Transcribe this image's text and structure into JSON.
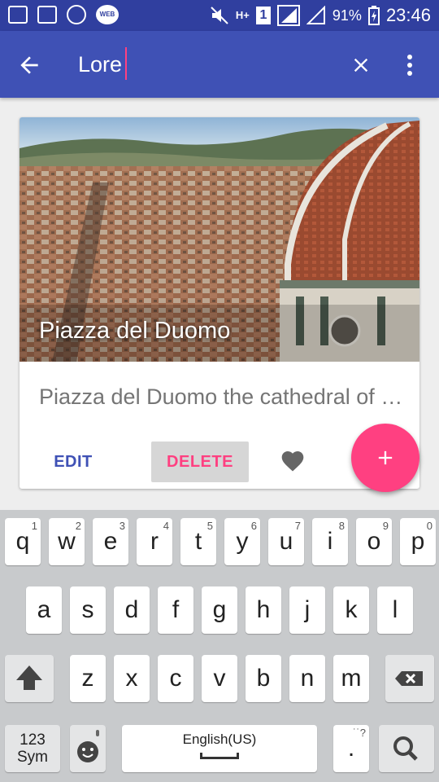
{
  "status_bar": {
    "battery": "91%",
    "network": "H+",
    "sim": "1",
    "time": "23:46",
    "app_icons": [
      "keyboard-icon",
      "gallery-icon",
      "whatsapp-icon",
      "webtoon-icon"
    ],
    "webtoon_label": "WEB TOON"
  },
  "toolbar": {
    "search_value": "Lore",
    "back_icon": "arrow-back-icon",
    "clear_icon": "close-icon",
    "more_icon": "more-vert-icon"
  },
  "card": {
    "image_title": "Piazza del Duomo",
    "description": "Piazza del Duomo the cathedral of Florence",
    "edit_label": "EDIT",
    "delete_label": "DELETE",
    "favorite_icon": "heart-icon"
  },
  "fab": {
    "icon": "plus-icon"
  },
  "keyboard": {
    "row1": [
      {
        "k": "q",
        "h": "1"
      },
      {
        "k": "w",
        "h": "2"
      },
      {
        "k": "e",
        "h": "3"
      },
      {
        "k": "r",
        "h": "4"
      },
      {
        "k": "t",
        "h": "5"
      },
      {
        "k": "y",
        "h": "6"
      },
      {
        "k": "u",
        "h": "7"
      },
      {
        "k": "i",
        "h": "8"
      },
      {
        "k": "o",
        "h": "9"
      },
      {
        "k": "p",
        "h": "0"
      }
    ],
    "row2": [
      "a",
      "s",
      "d",
      "f",
      "g",
      "h",
      "j",
      "k",
      "l"
    ],
    "row3": [
      "z",
      "x",
      "c",
      "v",
      "b",
      "n",
      "m"
    ],
    "sym_label_1": "123",
    "sym_label_2": "Sym",
    "space_label": "English(US)",
    "period_label": ".",
    "period_hint": "˙˙?"
  },
  "colors": {
    "primary": "#3f51b5",
    "primary_dark": "#303f9f",
    "accent": "#ff4081"
  }
}
